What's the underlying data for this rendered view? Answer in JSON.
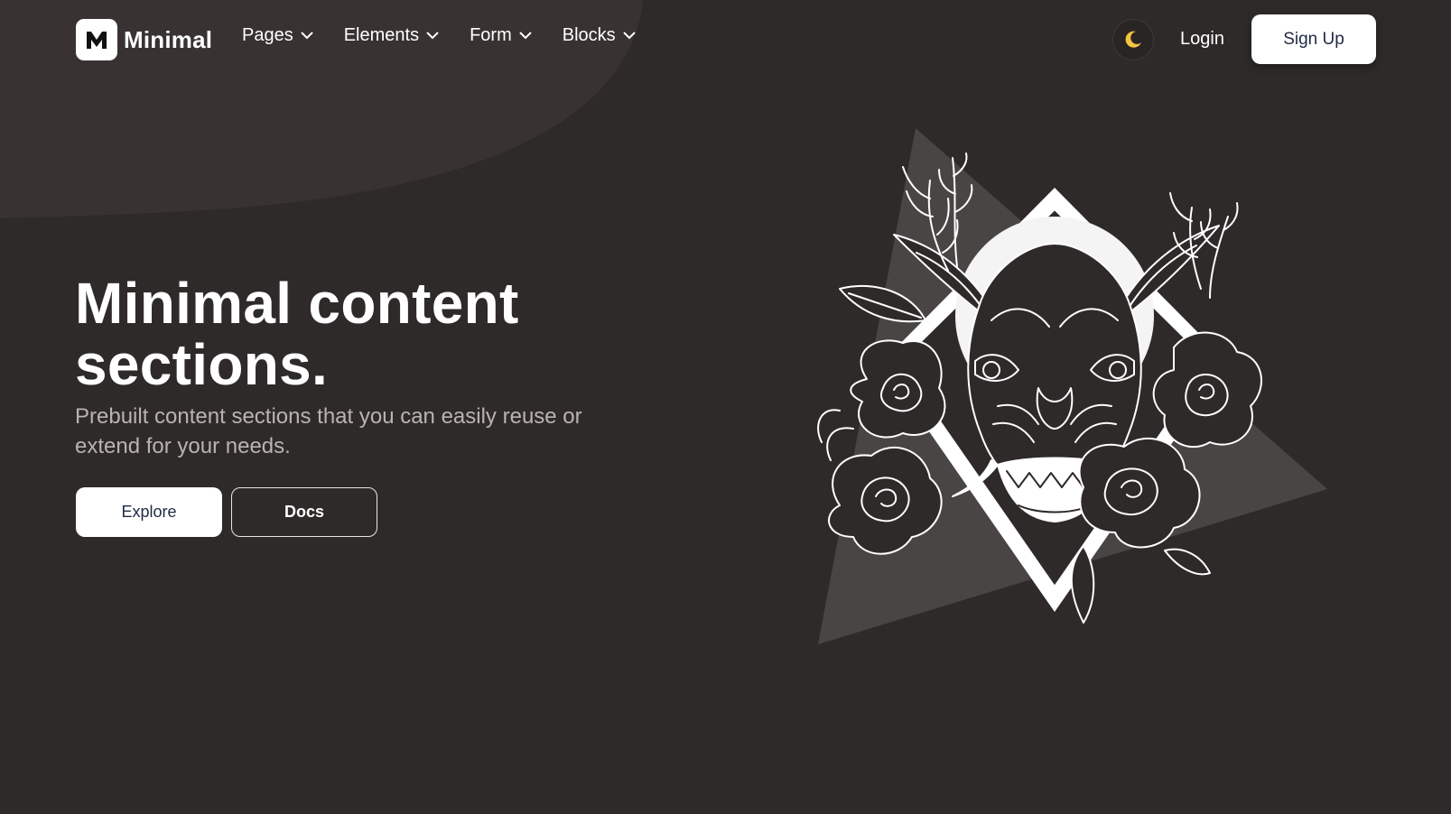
{
  "nav": {
    "brand": "Minimal",
    "logo_letter": "M",
    "menu": [
      {
        "label": "Pages"
      },
      {
        "label": "Elements"
      },
      {
        "label": "Form"
      },
      {
        "label": "Blocks"
      }
    ],
    "theme_icon": "moon-icon",
    "login_label": "Login",
    "signup_label": "Sign Up"
  },
  "hero": {
    "title": "Minimal content sections.",
    "subtitle": "Prebuilt content sections that you can easily reuse or extend for your needs.",
    "explore_label": "Explore",
    "docs_label": "Docs",
    "illustration_icon": "oni-mask-roses-illustration"
  },
  "colors": {
    "background": "#2f2a2a",
    "accent_moon": "#f5c542",
    "button_text": "#1f2a44",
    "subtitle": "#b9b3b3"
  }
}
